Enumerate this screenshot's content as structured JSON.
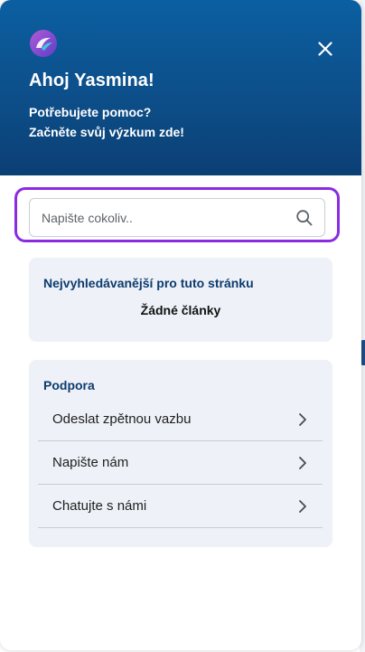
{
  "header": {
    "greeting": "Ahoj Yasmina!",
    "subtitle_line1": "Potřebujete pomoc?",
    "subtitle_line2": "Začněte svůj výzkum zde!",
    "logo_icon": "brand-logo-icon",
    "close_icon": "close-icon"
  },
  "search": {
    "placeholder": "Napište cokoliv..",
    "value": "",
    "icon": "search-icon"
  },
  "popular": {
    "title": "Nejvyhledávanější pro tuto stránku",
    "empty_text": "Žádné články"
  },
  "support": {
    "title": "Podpora",
    "items": [
      {
        "label": "Odeslat zpětnou vazbu"
      },
      {
        "label": "Napište nám"
      },
      {
        "label": "Chatujte s námi"
      }
    ]
  },
  "colors": {
    "header_top": "#0b5fa1",
    "header_bottom": "#0b3f74",
    "focus_outline": "#8a2be2",
    "card_bg": "#eef1f7",
    "card_title": "#0d3c6e"
  }
}
